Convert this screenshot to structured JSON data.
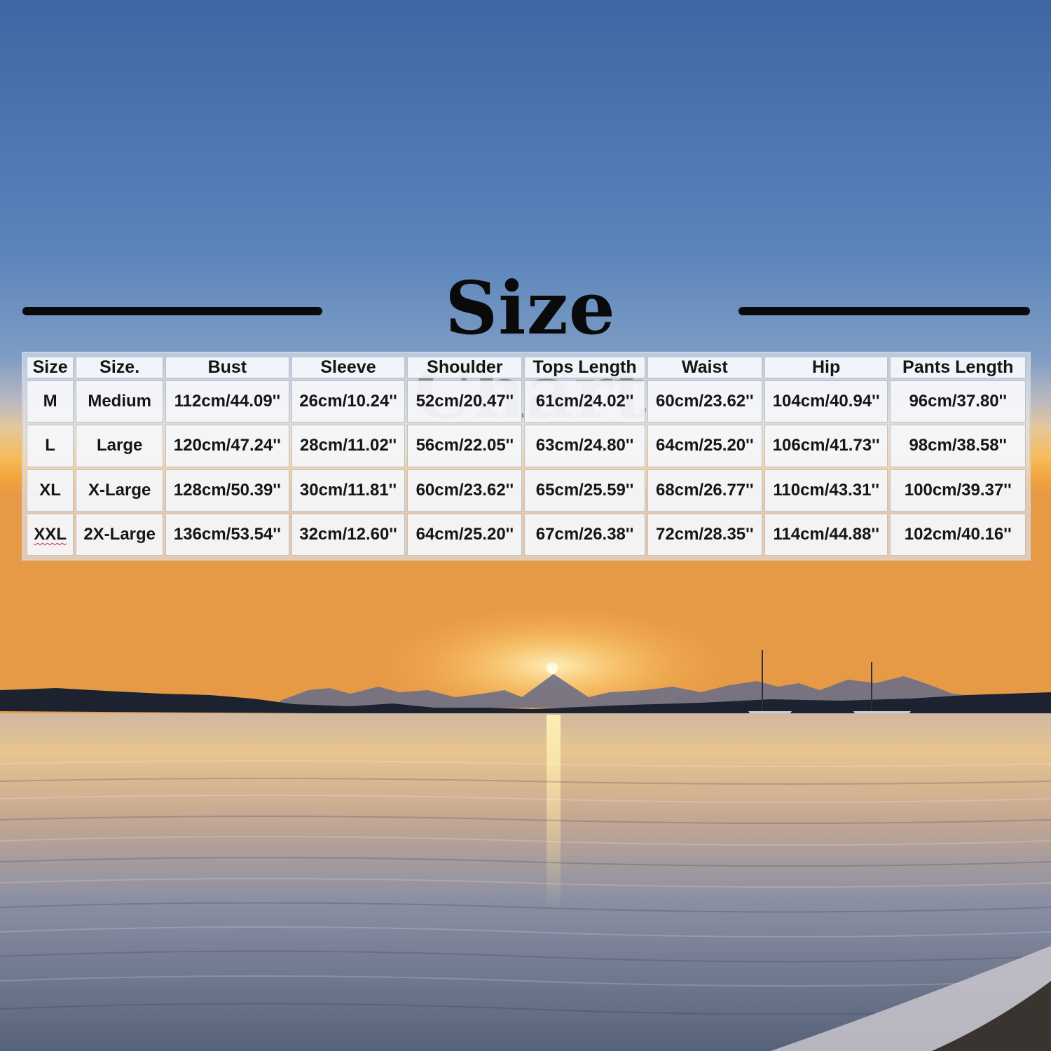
{
  "title": "Size Chart",
  "colors": {
    "sky_top": "#3f68a3",
    "sky_mid": "#6f93bf",
    "horizon_glow": "#f6b24a",
    "sun": "#fff6c8",
    "water": "#6f7c94",
    "title_text": "#0a0a0a"
  },
  "table": {
    "headers": [
      "Size",
      "Size.",
      "Bust",
      "Sleeve",
      "Shoulder",
      "Tops Length",
      "Waist",
      "Hip",
      "Pants Length"
    ],
    "rows": [
      [
        "M",
        "Medium",
        "112cm/44.09''",
        "26cm/10.24''",
        "52cm/20.47''",
        "61cm/24.02''",
        "60cm/23.62''",
        "104cm/40.94''",
        "96cm/37.80''"
      ],
      [
        "L",
        "Large",
        "120cm/47.24''",
        "28cm/11.02''",
        "56cm/22.05''",
        "63cm/24.80''",
        "64cm/25.20''",
        "106cm/41.73''",
        "98cm/38.58''"
      ],
      [
        "XL",
        "X-Large",
        "128cm/50.39''",
        "30cm/11.81''",
        "60cm/23.62''",
        "65cm/25.59''",
        "68cm/26.77''",
        "110cm/43.31''",
        "100cm/39.37''"
      ],
      [
        "XXL",
        "2X-Large",
        "136cm/53.54''",
        "32cm/12.60''",
        "64cm/25.20''",
        "67cm/26.38''",
        "72cm/28.35''",
        "114cm/44.88''",
        "102cm/40.16''"
      ]
    ]
  }
}
